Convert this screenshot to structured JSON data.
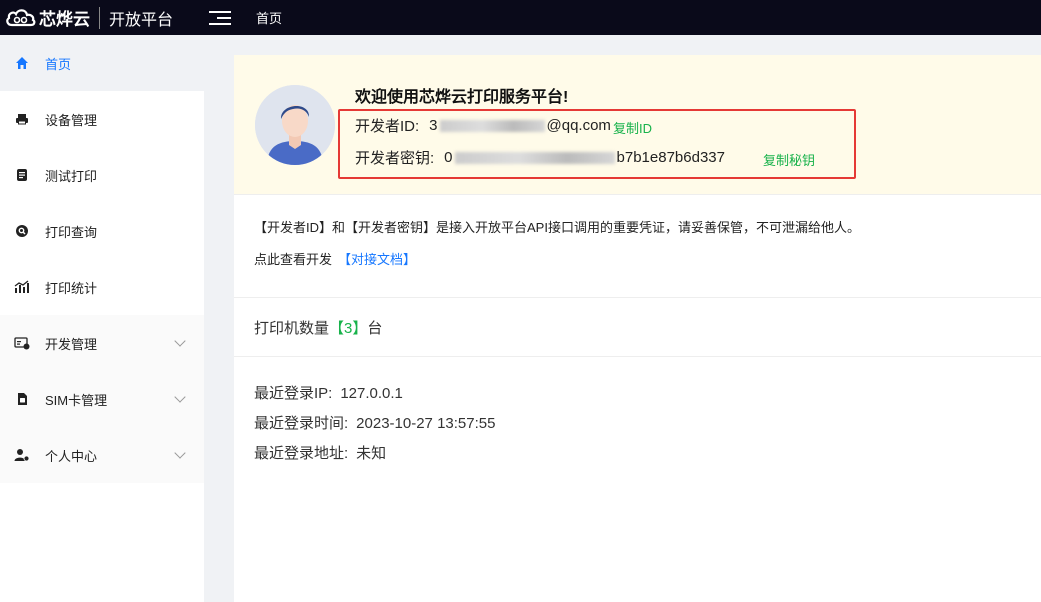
{
  "brand": {
    "name": "芯烨云",
    "platform": "开放平台"
  },
  "topbar": {
    "home_label": "首页"
  },
  "sidebar": {
    "items": [
      {
        "label": "首页",
        "icon": "home-icon",
        "active": true
      },
      {
        "label": "设备管理",
        "icon": "printer-icon"
      },
      {
        "label": "测试打印",
        "icon": "document-icon"
      },
      {
        "label": "打印查询",
        "icon": "search-icon"
      },
      {
        "label": "打印统计",
        "icon": "bar-chart-icon"
      },
      {
        "label": "开发管理",
        "icon": "dev-card-icon",
        "expandable": true
      },
      {
        "label": "SIM卡管理",
        "icon": "sim-card-icon",
        "expandable": true
      },
      {
        "label": "个人中心",
        "icon": "user-settings-icon",
        "expandable": true
      }
    ]
  },
  "welcome": {
    "title": "欢迎使用芯烨云打印服务平台!",
    "developer_id_label": "开发者ID:",
    "developer_id_visible_suffix": "@qq.com",
    "developer_id_visible_prefix": "3",
    "copy_id": "复制ID",
    "developer_key_label": "开发者密钥:",
    "developer_key_visible_prefix": "0",
    "developer_key_visible_suffix": "b7b1e87b6d337",
    "copy_key": "复制秘钥"
  },
  "info": {
    "notice": "【开发者ID】和【开发者密钥】是接入开放平台API接口调用的重要凭证，请妥善保管，不可泄漏给他人。",
    "doc_prefix": "点此查看开发",
    "doc_link": "【对接文档】"
  },
  "printer": {
    "prefix": "打印机数量",
    "count": "【3】",
    "suffix": "台"
  },
  "login": {
    "ip_label": "最近登录IP:",
    "ip": "127.0.0.1",
    "time_label": "最近登录时间:",
    "time": "2023-10-27 13:57:55",
    "addr_label": "最近登录地址:",
    "addr": "未知"
  },
  "colors": {
    "accent": "#1677ff",
    "success": "#18b24b",
    "highlight": "#e53935",
    "topbar": "#0a0a1a"
  }
}
